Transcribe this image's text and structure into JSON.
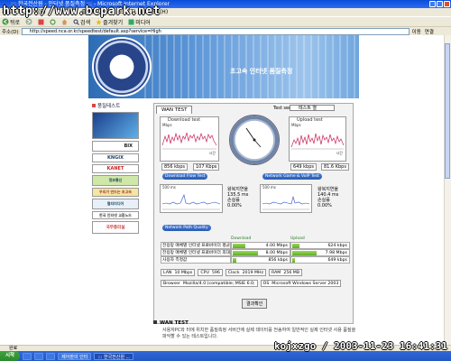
{
  "window": {
    "title": "::: 한국전산원 - 인터넷 품질측정 ::: - Microsoft Internet Explorer"
  },
  "watermark": "http://www.bcpark.net",
  "menubar": {
    "items": [
      "파일(F)",
      "편집(E)",
      "보기(V)",
      "즐겨찾기(A)",
      "도구(T)",
      "도움말(H)"
    ]
  },
  "toolbar": {
    "back": "뒤로",
    "forward": "",
    "search": "검색",
    "favorites": "즐겨찾기",
    "media": "미디어"
  },
  "addressbar": {
    "label": "주소(D)",
    "url": "http://speed.nca.or.kr/speedtest/default.asp?servlce=High",
    "go": "이동",
    "links": "연결"
  },
  "banner": {
    "title": "초고속 인터넷 품질측정"
  },
  "left_panel": {
    "title": "품질테스트",
    "banners": [
      "BIX",
      "KNGIX",
      "KANET",
      "정보통신",
      "우리가 만드는 초고속",
      "멀티미디어",
      "한국 인터넷 교환노드",
      "국무총리실"
    ]
  },
  "wan": {
    "tab": "WAN TEST",
    "server_label": "Test server",
    "server_value": "테스트 열",
    "download": {
      "title": "Download test",
      "unit": "Mbps",
      "axis": "시간",
      "left_val": "856 kbps",
      "right_val": "107 Kbps"
    },
    "upload": {
      "title": "Upload test",
      "unit": "Mbps",
      "axis": "시간",
      "left_val": "649 kbps",
      "right_val": "81.6 Kbps"
    },
    "gauge_btn_left": "Download Flow Test",
    "gauge_btn_right": "Network Game & VoIP Test",
    "delay": {
      "unit_left": "500 ms",
      "stat1_label": "왕복지연율",
      "stat1_val": "135.5 ms",
      "stat2_label": "손실률",
      "stat2_val": "0.00%",
      "btn": "Network Path Quality"
    },
    "delay2": {
      "unit_left": "500 ms",
      "stat1_label": "왕복지연율",
      "stat1_val": "140.4 ms",
      "stat2_label": "손실률",
      "stat2_val": "0.00%"
    },
    "table": {
      "header_download": "Download",
      "header_upload": "Upload",
      "rows": [
        {
          "label": "전용망 매체별 인터넷 프로바이더 평균",
          "dl": "4.00 Mbps",
          "ul": "624 kbps",
          "dl_frac": 0.45,
          "ul_frac": 0.25
        },
        {
          "label": "전용망 매체별 인터넷 프로바이더 최대값",
          "dl": "8.00 Mbps",
          "ul": "7.98 Mbps",
          "dl_frac": 0.9,
          "ul_frac": 0.88
        },
        {
          "label": "사용자 측정값",
          "dl": "856 kbps",
          "ul": "649 kbps",
          "dl_frac": 0.12,
          "ul_frac": 0.1
        }
      ]
    },
    "info": {
      "lan_label": "LAN",
      "lan_val": "10 Mbps",
      "cpu_label": "CPU",
      "cpu_val": "596",
      "clock_label": "Clock",
      "clock_val": "2019 MHz",
      "ram_label": "RAM",
      "ram_val": "256 MB",
      "browser_label": "Browser",
      "browser_val": "Mozilla/4.0 (compatible; MSIE 6.0;",
      "os_label": "OS",
      "os_val": "Microsoft Windows Server 2003"
    },
    "result_btn": "결과확인"
  },
  "description": {
    "title": "WAN TEST",
    "text": "사용자PC와 터에 위치한 품질측정 서버간에 실제 데이터를 전송하여 일반적인 실제 인터넷 사용 품질을 파악할 수 있는 테스트입니다."
  },
  "statusbar": {
    "text": "완료"
  },
  "taskbar": {
    "start": "시작",
    "items": [
      "",
      "",
      "",
      "제어판의 인터",
      "::: 한국전산원 ..."
    ],
    "clock_mark": "kojxzgo / 2003-11-23 16:41:31"
  }
}
